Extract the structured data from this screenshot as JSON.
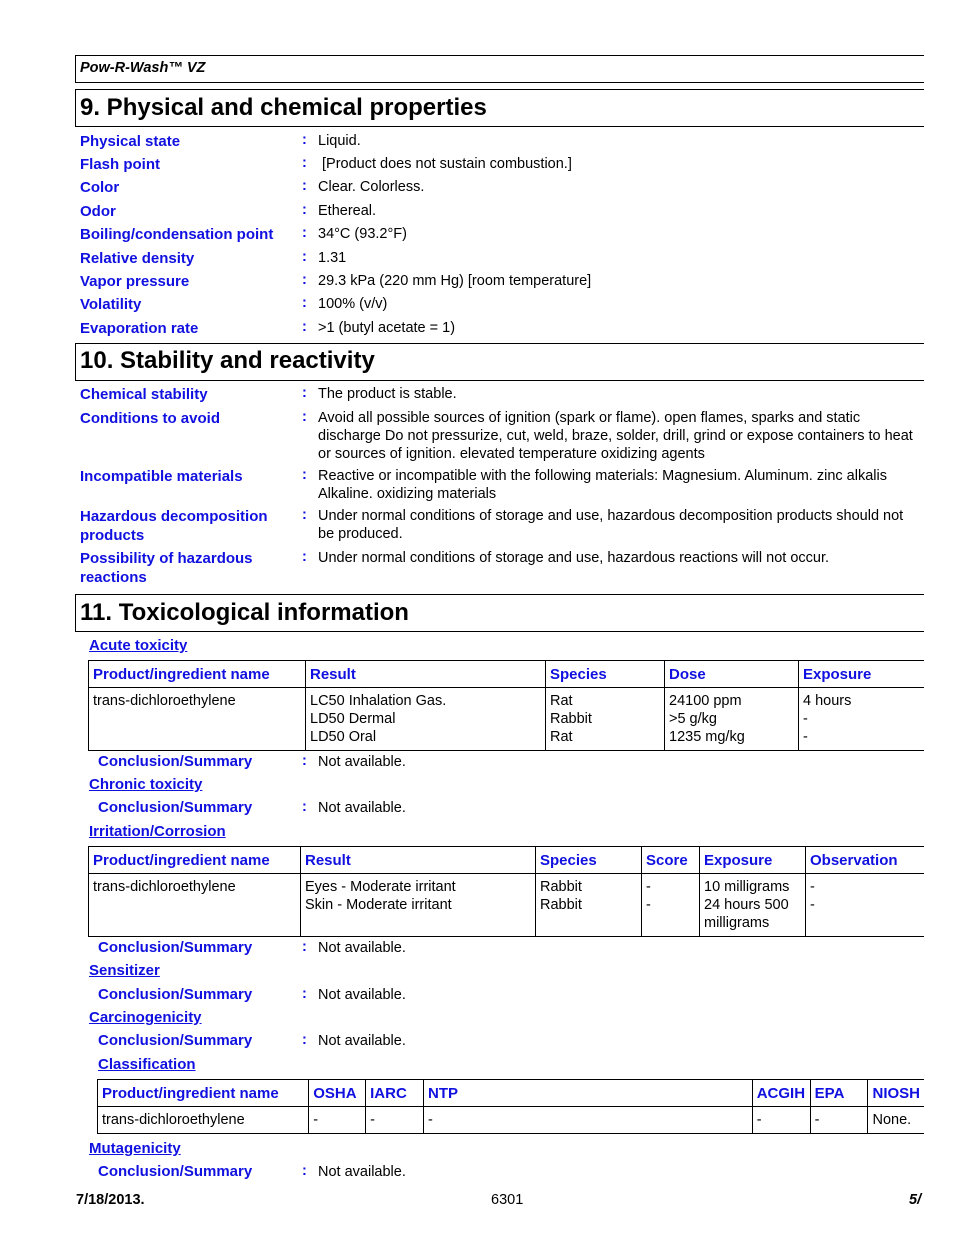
{
  "header": {
    "product_name": "Pow-R-Wash™ VZ"
  },
  "section9": {
    "title": "9. Physical and chemical properties",
    "properties": [
      {
        "label": "Physical state",
        "value": "Liquid."
      },
      {
        "label": "Flash point",
        "value": "[Product does not sustain combustion.]"
      },
      {
        "label": "Color",
        "value": "Clear. Colorless."
      },
      {
        "label": "Odor",
        "value": "Ethereal."
      },
      {
        "label": "Boiling/condensation point",
        "value": "34°C (93.2°F)"
      },
      {
        "label": "Relative density",
        "value": "1.31"
      },
      {
        "label": "Vapor pressure",
        "value": "29.3 kPa (220 mm Hg) [room temperature]"
      },
      {
        "label": "Volatility",
        "value": "100% (v/v)"
      },
      {
        "label": "Evaporation rate",
        "value": ">1 (butyl acetate = 1)"
      }
    ]
  },
  "section10": {
    "title": "10. Stability and reactivity",
    "properties": [
      {
        "label": "Chemical stability",
        "value": "The product is stable."
      },
      {
        "label": "Conditions to avoid",
        "value": "Avoid all possible sources of ignition (spark or flame). open flames, sparks and static discharge Do not pressurize, cut, weld, braze, solder, drill, grind or expose containers to heat or sources of ignition. elevated temperature oxidizing agents"
      },
      {
        "label": "Incompatible materials",
        "value": "Reactive or incompatible with the following materials: Magnesium. Aluminum. zinc alkalis Alkaline. oxidizing materials"
      },
      {
        "label": "Hazardous decomposition products",
        "value": "Under normal conditions of storage and use, hazardous decomposition products should not be produced."
      },
      {
        "label": "Possibility of hazardous reactions",
        "value": "Under normal conditions of storage and use, hazardous reactions will not occur."
      }
    ]
  },
  "section11": {
    "title": "11. Toxicological information",
    "colon": ":",
    "conclusion_label": "Conclusion/Summary",
    "acute": {
      "heading": "Acute toxicity",
      "columns": [
        "Product/ingredient name",
        "Result",
        "Species",
        "Dose",
        "Exposure"
      ],
      "row": {
        "name": "trans-dichloroethylene",
        "result": [
          "LC50 Inhalation Gas.",
          "LD50 Dermal",
          "LD50 Oral"
        ],
        "species": [
          "Rat",
          "Rabbit",
          "Rat"
        ],
        "dose": [
          "24100 ppm",
          ">5 g/kg",
          "1235 mg/kg"
        ],
        "exposure": [
          "4 hours",
          "-",
          "-"
        ]
      },
      "conclusion": "Not available."
    },
    "chronic": {
      "heading": "Chronic toxicity",
      "conclusion": "Not available."
    },
    "irritation": {
      "heading": "Irritation/Corrosion",
      "columns": [
        "Product/ingredient name",
        "Result",
        "Species",
        "Score",
        "Exposure",
        "Observation"
      ],
      "row": {
        "name": "trans-dichloroethylene",
        "result": [
          "Eyes - Moderate irritant",
          "Skin - Moderate irritant"
        ],
        "species": [
          "Rabbit",
          "Rabbit"
        ],
        "score": [
          "-",
          "-"
        ],
        "exposure": [
          "10 milligrams",
          "24 hours 500",
          "milligrams"
        ],
        "observation": [
          "-",
          "-"
        ]
      },
      "conclusion": "Not available."
    },
    "sensitizer": {
      "heading": "Sensitizer",
      "conclusion": "Not available."
    },
    "carcinogenicity": {
      "heading": "Carcinogenicity",
      "conclusion": "Not available.",
      "classification": {
        "heading": "Classification",
        "columns": [
          "Product/ingredient name",
          "OSHA",
          "IARC",
          "NTP",
          "ACGIH",
          "EPA",
          "NIOSH"
        ],
        "row": [
          "trans-dichloroethylene",
          "-",
          "-",
          "-",
          "-",
          "-",
          "None."
        ]
      }
    },
    "mutagenicity": {
      "heading": "Mutagenicity",
      "conclusion": "Not available."
    }
  },
  "footer": {
    "date": "7/18/2013.",
    "code": "6301",
    "page": "5/"
  }
}
